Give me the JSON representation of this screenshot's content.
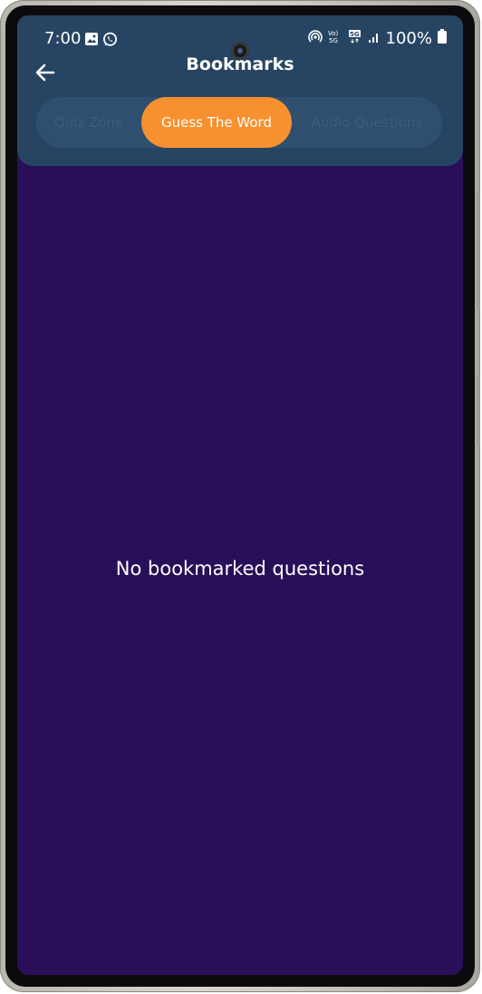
{
  "status_bar": {
    "time": "7:00",
    "battery": "100%",
    "icons": [
      "gallery-icon",
      "whatsapp-icon",
      "hotspot-icon",
      "volte-icon",
      "5g-icon",
      "signal-icon",
      "battery-icon"
    ]
  },
  "header": {
    "title": "Bookmarks",
    "back_icon": "arrow-left-icon"
  },
  "tabs": [
    {
      "label": "Quiz Zone",
      "active": false
    },
    {
      "label": "Guess The Word",
      "active": true
    },
    {
      "label": "Audio Questions",
      "active": false
    }
  ],
  "content": {
    "empty_message": "No bookmarked questions"
  },
  "colors": {
    "background": "#290f59",
    "appbar": "#274563",
    "active_tab": "#f7902e"
  }
}
